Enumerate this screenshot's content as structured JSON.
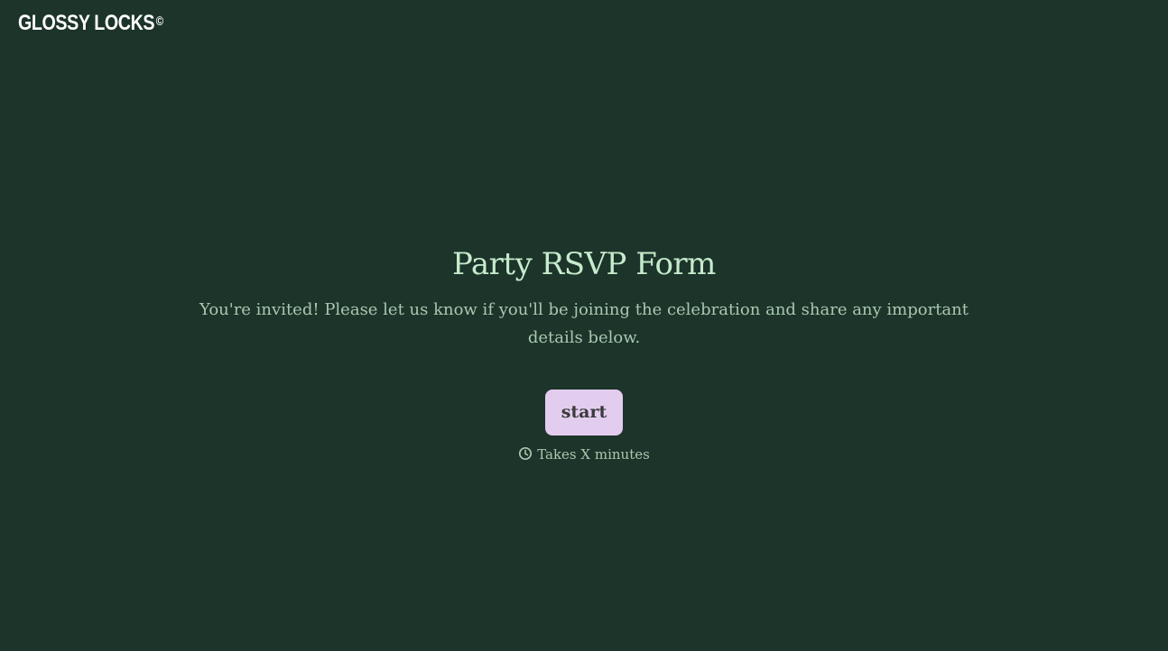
{
  "brand": {
    "name": "GLOSSY LOCKS",
    "mark": "©"
  },
  "welcome": {
    "title": "Party RSVP Form",
    "description": "You're invited! Please let us know if you'll be joining the celebration and share any important details below.",
    "start_label": "start",
    "duration_icon": "clock-icon",
    "duration_text": "Takes X minutes"
  },
  "colors": {
    "background": "#1c342a",
    "title": "#c6ebcd",
    "text": "#a9c8b0",
    "button": "#e3cdef",
    "button_text": "#3b3b3b"
  }
}
